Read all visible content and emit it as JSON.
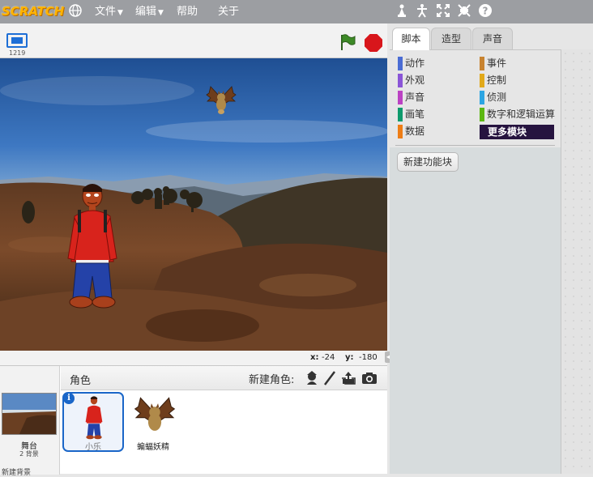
{
  "menubar": {
    "logo": "SCRATCH",
    "items": [
      {
        "label": "文件",
        "has_caret": true
      },
      {
        "label": "编辑",
        "has_caret": true
      },
      {
        "label": "帮助",
        "has_caret": false
      },
      {
        "label": "关于",
        "has_caret": false
      }
    ],
    "icons": [
      "globe-icon",
      "duplicate-icon",
      "cut-icon",
      "grow-icon",
      "shrink-icon",
      "help-icon"
    ]
  },
  "stage": {
    "version": "1219",
    "coords": {
      "x_label": "x:",
      "x_value": "-24",
      "y_label": "y:",
      "y_value": "-180"
    }
  },
  "sprites": {
    "title": "角色",
    "new_sprite_label": "新建角色:",
    "stage_label": "舞台",
    "stage_bg_count": "2 背景",
    "new_backdrop": "新建背景",
    "list": [
      {
        "name": "小乐",
        "selected": true
      },
      {
        "name": "蝙蝠妖精",
        "selected": false
      }
    ]
  },
  "tabs": [
    {
      "label": "脚本",
      "active": true
    },
    {
      "label": "造型",
      "active": false
    },
    {
      "label": "声音",
      "active": false
    }
  ],
  "palette": {
    "categories": [
      {
        "label": "动作",
        "color": "#4a6cd4"
      },
      {
        "label": "事件",
        "color": "#c88330"
      },
      {
        "label": "外观",
        "color": "#8a55d7"
      },
      {
        "label": "控制",
        "color": "#e1a91a"
      },
      {
        "label": "声音",
        "color": "#bb42c3"
      },
      {
        "label": "侦测",
        "color": "#2ca5e2"
      },
      {
        "label": "画笔",
        "color": "#0e9a6c"
      },
      {
        "label": "数字和逻辑运算",
        "color": "#5cb712"
      },
      {
        "label": "数据",
        "color": "#ee7d16"
      },
      {
        "label": "更多模块",
        "color": "#632d99"
      }
    ],
    "selected": "更多模块",
    "new_block_button": "新建功能块"
  }
}
